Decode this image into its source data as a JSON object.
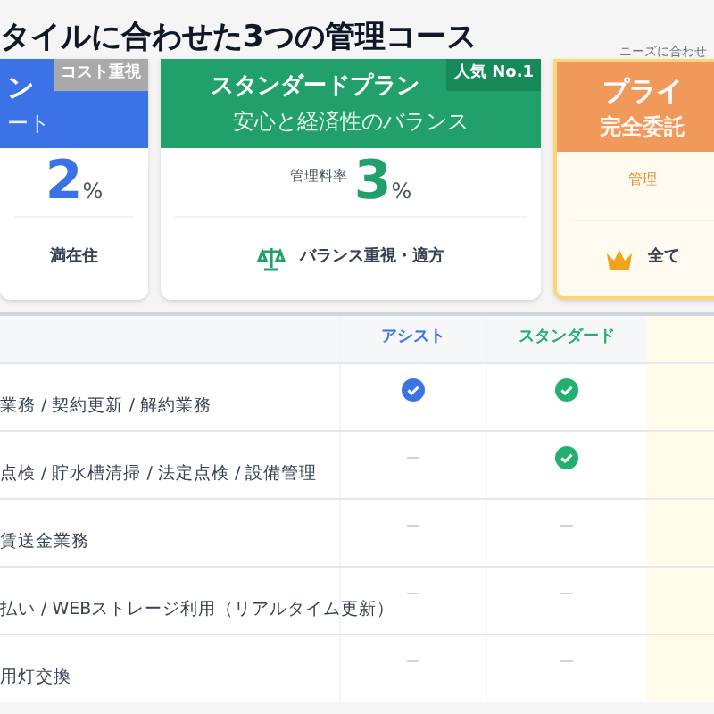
{
  "heading": "タイルに合わせた3つの管理コース",
  "note": "ニーズに合わせ",
  "plans": [
    {
      "kind": "assist",
      "title": "ン",
      "badge": "コスト重視",
      "subtitle": "ート",
      "rate": "2",
      "unit": "%",
      "feature": "満在住"
    },
    {
      "kind": "standard",
      "title": "スタンダードプラン",
      "badge": "人気 No.1",
      "subtitle": "安心と経済性のバランス",
      "rate_label": "管理料率",
      "rate": "3",
      "unit": "%",
      "feature": "バランス重視・適方"
    },
    {
      "kind": "premium",
      "title": "プライ",
      "subtitle": "完全委託",
      "rate_label": "管理",
      "feature": "全て"
    }
  ],
  "table": {
    "columns": [
      "アシスト",
      "スタンダード"
    ],
    "rows": [
      {
        "label": "業務 / 契約更新 / 解約業務",
        "cells": [
          {
            "checked": true
          },
          {
            "checked": true
          }
        ]
      },
      {
        "label": "点検 / 貯水槽清掃 / 法定点検 / 設備管理",
        "cells": [
          {
            "checked": false
          },
          {
            "checked": true
          }
        ]
      },
      {
        "label": "賃送金業務",
        "cells": [
          {
            "checked": false
          },
          {
            "checked": false
          }
        ]
      },
      {
        "label": "払い / WEBストレージ利用（リアルタイム更新）",
        "cells": [
          {
            "checked": false
          },
          {
            "checked": false
          }
        ]
      },
      {
        "label": "用灯交換",
        "cells": [
          {
            "checked": false
          },
          {
            "checked": false
          }
        ]
      }
    ]
  }
}
